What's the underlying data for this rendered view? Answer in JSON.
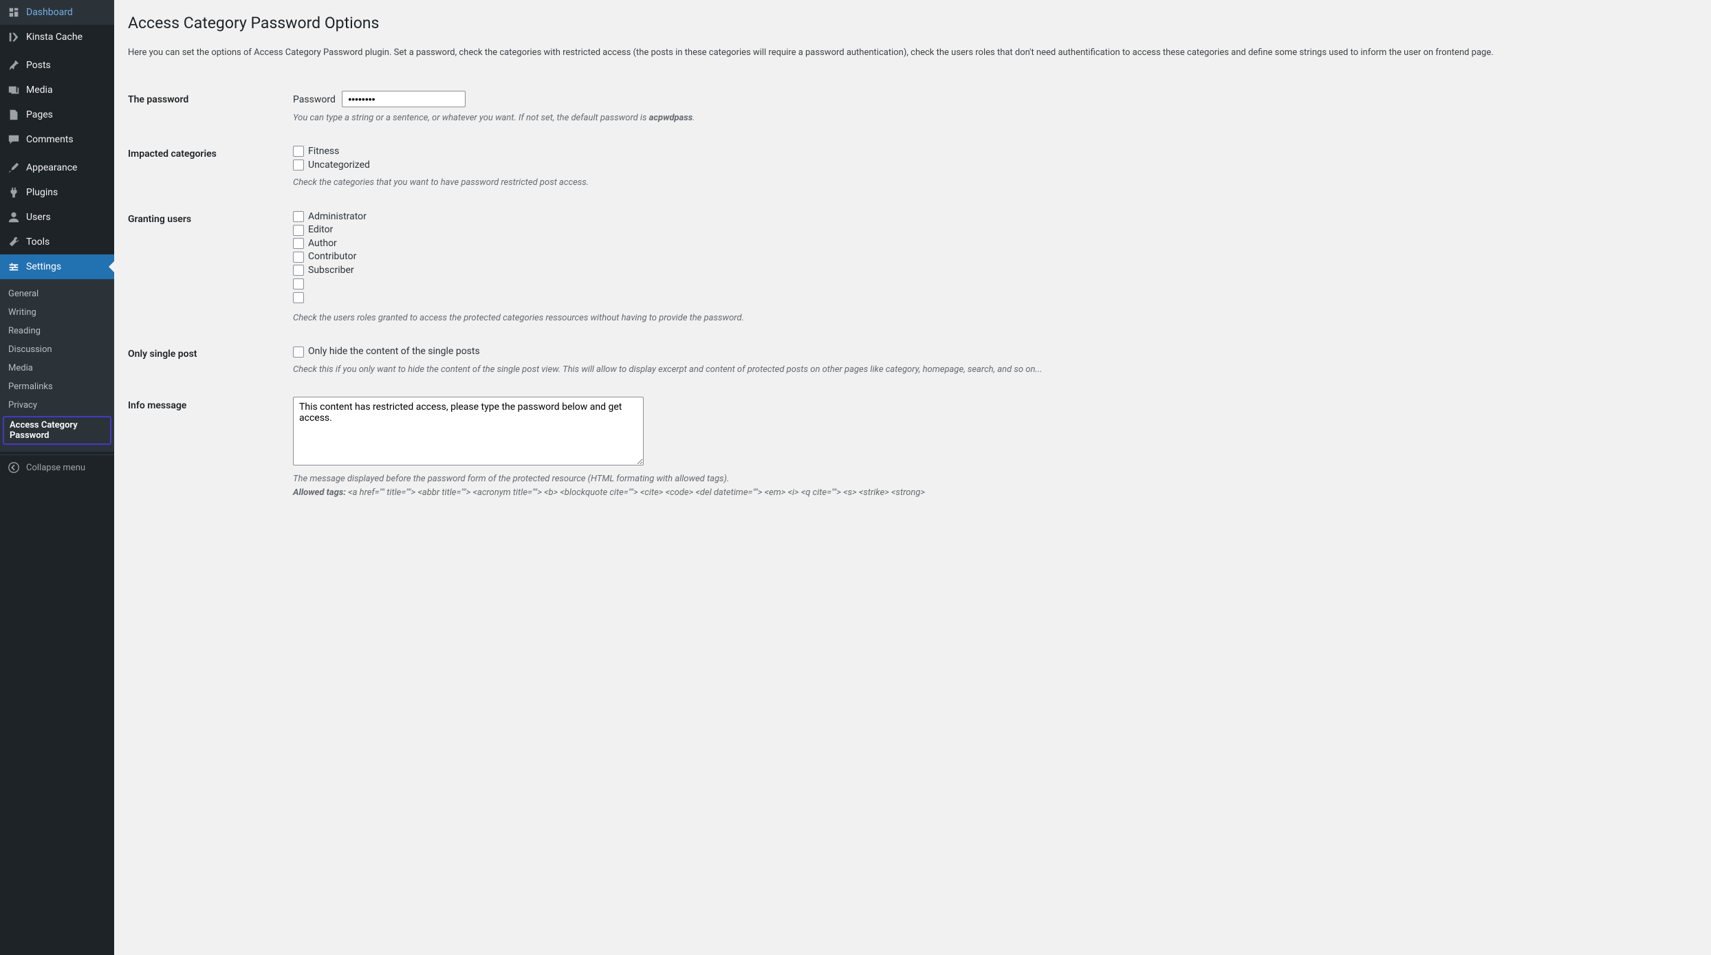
{
  "sidebar": {
    "items": [
      {
        "label": "Dashboard",
        "icon": "dashboard"
      },
      {
        "label": "Kinsta Cache",
        "icon": "kinsta"
      },
      {
        "label": "Posts",
        "icon": "pin"
      },
      {
        "label": "Media",
        "icon": "media"
      },
      {
        "label": "Pages",
        "icon": "page"
      },
      {
        "label": "Comments",
        "icon": "comment"
      },
      {
        "label": "Appearance",
        "icon": "brush"
      },
      {
        "label": "Plugins",
        "icon": "plug"
      },
      {
        "label": "Users",
        "icon": "user"
      },
      {
        "label": "Tools",
        "icon": "tool"
      },
      {
        "label": "Settings",
        "icon": "settings"
      }
    ],
    "submenu": [
      {
        "label": "General"
      },
      {
        "label": "Writing"
      },
      {
        "label": "Reading"
      },
      {
        "label": "Discussion"
      },
      {
        "label": "Media"
      },
      {
        "label": "Permalinks"
      },
      {
        "label": "Privacy"
      },
      {
        "label": "Access Category Password"
      }
    ],
    "collapse": "Collapse menu"
  },
  "page": {
    "title": "Access Category Password Options",
    "intro": "Here you can set the options of Access Category Password plugin. Set a password, check the categories with restricted access (the posts in these categories will require a password authentication), check the users roles that don't need authentification to access these categories and define some strings used to inform the user on frontend page."
  },
  "form": {
    "password": {
      "th": "The password",
      "label": "Password",
      "value": "••••••••",
      "desc_pre": "You can type a string or a sentence, or whatever you want. If not set, the default password is ",
      "desc_strong": "acpwdpass",
      "desc_post": "."
    },
    "categories": {
      "th": "Impacted categories",
      "opts": [
        {
          "label": "Fitness"
        },
        {
          "label": "Uncategorized"
        }
      ],
      "desc": "Check the categories that you want to have password restricted post access."
    },
    "users": {
      "th": "Granting users",
      "opts": [
        {
          "label": "Administrator"
        },
        {
          "label": "Editor"
        },
        {
          "label": "Author"
        },
        {
          "label": "Contributor"
        },
        {
          "label": "Subscriber"
        },
        {
          "label": ""
        },
        {
          "label": ""
        }
      ],
      "desc": "Check the users roles granted to access the protected categories ressources without having to provide the password."
    },
    "single": {
      "th": "Only single post",
      "label": "Only hide the content of the single posts",
      "desc": "Check this if you only want to hide the content of the single post view. This will allow to display excerpt and content of protected posts on other pages like category, homepage, search, and so on..."
    },
    "info": {
      "th": "Info message",
      "value": "This content has restricted access, please type the password below and get access.",
      "desc": "The message displayed before the password form of the protected resource (HTML formating with allowed tags).",
      "allowed_label": "Allowed tags: ",
      "allowed_tags": "<a href=\"\" title=\"\"> <abbr title=\"\"> <acronym title=\"\"> <b> <blockquote cite=\"\"> <cite> <code> <del datetime=\"\"> <em> <i> <q cite=\"\"> <s> <strike> <strong>"
    }
  }
}
